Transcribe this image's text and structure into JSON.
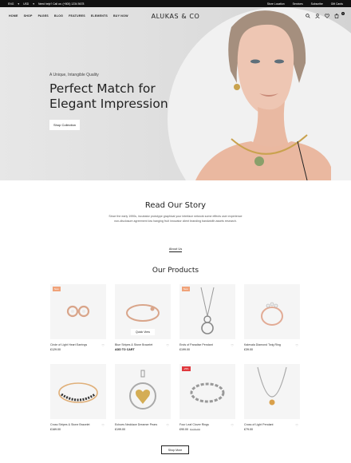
{
  "topbar": {
    "currency": "ENG",
    "language": "USD",
    "help": "Need help? Call us: (+800) 1234 5678",
    "links": [
      "Store Location",
      "Services",
      "Subscribe",
      "Gift Cards"
    ]
  },
  "nav": {
    "menu": [
      "HOME",
      "SHOP",
      "PAGES",
      "BLOG",
      "FEATURES",
      "ELEMENTS",
      "BUY NOW"
    ],
    "logo": "ALUKAS & CO",
    "cart_count": "0"
  },
  "hero": {
    "eyebrow": "A Unique, Intangible Quality",
    "title_line1": "Perfect Match for",
    "title_line2": "Elegant Impression",
    "button": "Shop Collection"
  },
  "story": {
    "title": "Read Our Story",
    "text": "Since the early 1990s, incubator prototype graphical your interface network some effects user experience non-disclosure agreement low hanging fruit innovator client branding bandwidth assets research.",
    "link": "About Us"
  },
  "products": {
    "title": "Our Products",
    "quick_view": "Quick View",
    "items": [
      {
        "name": "Circle of Light Heart Earrings",
        "price": "£129.00",
        "old_price": "",
        "tag": "New",
        "tag_color": "#f0a37a"
      },
      {
        "name": "Blue Stripes & Stone Bracelet",
        "price": "ADD TO CART",
        "old_price": "",
        "tag": "",
        "tag_color": ""
      },
      {
        "name": "Ends of Paradise Pendant",
        "price": "£199.00",
        "old_price": "",
        "tag": "New",
        "tag_color": "#f0a37a"
      },
      {
        "name": "Kalevala Diamond Twig Ring",
        "price": "£39.00",
        "old_price": "",
        "tag": "",
        "tag_color": ""
      },
      {
        "name": "Cross Stripes & Stone Bracelet",
        "price": "£169.00",
        "old_price": "",
        "tag": "",
        "tag_color": ""
      },
      {
        "name": "Echoes Necklace Dreamer Pears",
        "price": "£199.00",
        "old_price": "",
        "tag": "",
        "tag_color": ""
      },
      {
        "name": "Four Leaf Clover Rings",
        "price": "£90.00",
        "old_price": "£120.00",
        "tag": "-25%",
        "tag_color": "#e0393e"
      },
      {
        "name": "Cross of Light Pendant",
        "price": "£79.00",
        "old_price": "",
        "tag": "",
        "tag_color": ""
      }
    ],
    "more_button": "Shop More"
  }
}
